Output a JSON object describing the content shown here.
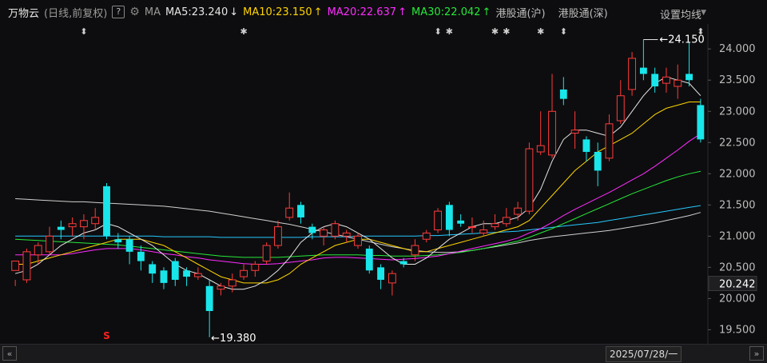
{
  "header": {
    "title": "万物云",
    "subtitle": "(日线,前复权)",
    "help": "?",
    "ma_label": "MA",
    "ma5": "MA5:23.240",
    "ma5_arrow": "↓",
    "ma10": "MA10:23.150",
    "ma10_arrow": "↑",
    "ma20": "MA20:22.637",
    "ma20_arrow": "↑",
    "ma30": "MA30:22.042",
    "ma30_arrow": "↑",
    "link_hk_sh": "港股通(沪)",
    "link_hk_sz": "港股通(深)",
    "settings": "设置均线"
  },
  "colors": {
    "up": "#ff3b3b",
    "down": "#18e6ea",
    "ma5": "#e6e6e6",
    "ma10": "#ffd400",
    "ma20": "#ff2cff",
    "ma30": "#27e83a",
    "ma60": "#27c8ff",
    "ma120": "#d0d0d0"
  },
  "footer": {
    "date": "2025/07/28/一",
    "left_icon": "double-chevron-left-icon",
    "right_icon": "double-chevron-right-icon"
  },
  "chart_data": {
    "type": "candlestick",
    "ylim": [
      19.3,
      24.4
    ],
    "y_ticks": [
      "24.000",
      "23.500",
      "23.000",
      "22.500",
      "22.000",
      "21.500",
      "21.000",
      "20.500",
      "20.000",
      "19.500"
    ],
    "y_tick_values": [
      24.0,
      23.5,
      23.0,
      22.5,
      22.0,
      21.5,
      21.0,
      20.5,
      20.0,
      19.5
    ],
    "current_price": "20.242",
    "current_price_value": 20.242,
    "high_annotation": {
      "label": "24.150",
      "value": 24.15
    },
    "low_annotation": {
      "label": "19.380",
      "value": 19.38
    },
    "candles": [
      [
        20.45,
        20.6,
        20.3,
        20.2
      ],
      [
        20.3,
        20.75,
        20.8,
        20.25
      ],
      [
        20.7,
        20.85,
        20.9,
        20.55
      ],
      [
        20.75,
        21.0,
        21.15,
        20.7
      ],
      [
        21.15,
        21.1,
        21.25,
        20.95
      ],
      [
        21.15,
        21.2,
        21.3,
        21.0
      ],
      [
        21.15,
        21.25,
        21.35,
        20.95
      ],
      [
        21.2,
        21.3,
        21.45,
        21.1
      ],
      [
        21.8,
        21.0,
        21.85,
        20.95
      ],
      [
        20.95,
        20.9,
        21.05,
        20.8
      ],
      [
        20.95,
        20.75,
        21.0,
        20.55
      ],
      [
        20.75,
        20.6,
        20.85,
        20.45
      ],
      [
        20.55,
        20.4,
        20.6,
        20.25
      ],
      [
        20.45,
        20.25,
        20.5,
        20.15
      ],
      [
        20.6,
        20.3,
        20.65,
        20.2
      ],
      [
        20.45,
        20.35,
        20.5,
        20.2
      ],
      [
        20.35,
        20.4,
        20.5,
        20.3
      ],
      [
        20.2,
        19.8,
        20.3,
        19.38
      ],
      [
        20.15,
        20.2,
        20.25,
        20.05
      ],
      [
        20.2,
        20.3,
        20.4,
        20.1
      ],
      [
        20.35,
        20.45,
        20.55,
        20.3
      ],
      [
        20.45,
        20.55,
        20.6,
        20.35
      ],
      [
        20.6,
        20.85,
        20.9,
        20.55
      ],
      [
        20.85,
        21.15,
        21.25,
        20.8
      ],
      [
        21.3,
        21.45,
        21.7,
        21.25
      ],
      [
        21.5,
        21.3,
        21.55,
        21.2
      ],
      [
        21.15,
        21.05,
        21.2,
        20.95
      ],
      [
        21.0,
        21.1,
        21.15,
        20.85
      ],
      [
        21.0,
        21.2,
        21.25,
        20.95
      ],
      [
        21.0,
        21.05,
        21.1,
        20.9
      ],
      [
        20.85,
        21.0,
        21.05,
        20.8
      ],
      [
        20.8,
        20.45,
        20.85,
        20.4
      ],
      [
        20.5,
        20.3,
        20.55,
        20.15
      ],
      [
        20.25,
        20.4,
        20.45,
        20.05
      ],
      [
        20.6,
        20.55,
        20.65,
        20.5
      ],
      [
        20.7,
        20.85,
        20.95,
        20.6
      ],
      [
        20.95,
        21.05,
        21.1,
        20.9
      ],
      [
        21.1,
        21.4,
        21.45,
        21.05
      ],
      [
        21.5,
        21.1,
        21.55,
        21.0
      ],
      [
        21.25,
        21.2,
        21.35,
        21.15
      ],
      [
        21.15,
        21.15,
        21.3,
        21.05
      ],
      [
        21.05,
        21.1,
        21.25,
        21.0
      ],
      [
        21.15,
        21.2,
        21.35,
        21.1
      ],
      [
        21.2,
        21.3,
        21.45,
        21.15
      ],
      [
        21.35,
        21.45,
        21.55,
        21.25
      ],
      [
        21.4,
        22.4,
        22.5,
        21.35
      ],
      [
        22.35,
        22.45,
        23.0,
        22.3
      ],
      [
        22.3,
        23.0,
        23.6,
        22.25
      ],
      [
        23.35,
        23.2,
        23.55,
        23.1
      ],
      [
        22.65,
        22.7,
        23.0,
        22.4
      ],
      [
        22.55,
        22.35,
        22.6,
        22.2
      ],
      [
        22.35,
        22.05,
        22.5,
        21.8
      ],
      [
        22.25,
        22.8,
        22.95,
        22.2
      ],
      [
        22.85,
        23.25,
        23.5,
        22.8
      ],
      [
        23.35,
        23.85,
        23.95,
        23.25
      ],
      [
        23.7,
        23.6,
        24.15,
        23.5
      ],
      [
        23.6,
        23.4,
        23.7,
        23.3
      ],
      [
        23.45,
        23.55,
        23.7,
        23.3
      ],
      [
        23.4,
        23.5,
        23.75,
        23.2
      ],
      [
        23.6,
        23.5,
        24.1,
        23.4
      ],
      [
        23.1,
        22.55,
        23.2,
        22.5
      ]
    ],
    "ma5": [
      20.4,
      20.45,
      20.55,
      20.7,
      20.85,
      20.95,
      21.05,
      21.1,
      21.2,
      21.15,
      21.05,
      20.95,
      20.85,
      20.7,
      20.55,
      20.45,
      20.4,
      20.3,
      20.2,
      20.15,
      20.15,
      20.2,
      20.3,
      20.45,
      20.65,
      20.9,
      21.05,
      21.15,
      21.2,
      21.15,
      21.05,
      20.95,
      20.8,
      20.65,
      20.55,
      20.55,
      20.65,
      20.8,
      20.95,
      21.05,
      21.15,
      21.2,
      21.2,
      21.25,
      21.3,
      21.45,
      21.75,
      22.2,
      22.55,
      22.7,
      22.7,
      22.65,
      22.6,
      22.75,
      23.0,
      23.25,
      23.45,
      23.55,
      23.5,
      23.45,
      23.25
    ],
    "ma10": [
      20.55,
      20.55,
      20.6,
      20.65,
      20.7,
      20.75,
      20.8,
      20.85,
      20.9,
      20.95,
      20.95,
      20.95,
      20.9,
      20.85,
      20.75,
      20.65,
      20.55,
      20.45,
      20.35,
      20.3,
      20.25,
      20.25,
      20.25,
      20.3,
      20.4,
      20.55,
      20.65,
      20.75,
      20.85,
      20.9,
      20.95,
      20.95,
      20.9,
      20.85,
      20.8,
      20.75,
      20.75,
      20.8,
      20.85,
      20.9,
      20.95,
      21.0,
      21.05,
      21.1,
      21.15,
      21.25,
      21.45,
      21.65,
      21.85,
      22.05,
      22.2,
      22.35,
      22.45,
      22.55,
      22.65,
      22.8,
      22.95,
      23.05,
      23.1,
      23.15,
      23.15
    ],
    "ma20": [
      20.7,
      20.7,
      20.7,
      20.7,
      20.7,
      20.72,
      20.75,
      20.78,
      20.8,
      20.8,
      20.8,
      20.78,
      20.75,
      20.72,
      20.7,
      20.67,
      20.65,
      20.62,
      20.6,
      20.58,
      20.56,
      20.55,
      20.55,
      20.56,
      20.58,
      20.6,
      20.62,
      20.65,
      20.66,
      20.66,
      20.65,
      20.64,
      20.63,
      20.62,
      20.63,
      20.64,
      20.66,
      20.68,
      20.72,
      20.76,
      20.8,
      20.84,
      20.88,
      20.92,
      20.97,
      21.05,
      21.12,
      21.22,
      21.33,
      21.43,
      21.52,
      21.61,
      21.7,
      21.8,
      21.9,
      22.0,
      22.12,
      22.25,
      22.38,
      22.52,
      22.64
    ],
    "ma30": [
      20.95,
      20.94,
      20.93,
      20.92,
      20.91,
      20.9,
      20.89,
      20.88,
      20.87,
      20.86,
      20.84,
      20.82,
      20.8,
      20.78,
      20.76,
      20.74,
      20.72,
      20.7,
      20.68,
      20.67,
      20.66,
      20.66,
      20.66,
      20.66,
      20.67,
      20.68,
      20.69,
      20.7,
      20.7,
      20.7,
      20.7,
      20.69,
      20.69,
      20.68,
      20.68,
      20.68,
      20.69,
      20.7,
      20.72,
      20.74,
      20.77,
      20.8,
      20.84,
      20.88,
      20.92,
      20.98,
      21.05,
      21.12,
      21.2,
      21.28,
      21.36,
      21.44,
      21.52,
      21.6,
      21.68,
      21.75,
      21.82,
      21.89,
      21.95,
      22.0,
      22.04
    ],
    "ma60": [
      21.0,
      21.0,
      21.0,
      21.0,
      21.0,
      21.0,
      21.0,
      21.0,
      21.0,
      21.0,
      21.0,
      21.0,
      21.0,
      20.99,
      20.99,
      20.99,
      20.99,
      20.99,
      20.98,
      20.98,
      20.98,
      20.98,
      20.98,
      20.98,
      20.98,
      20.98,
      20.99,
      20.99,
      20.99,
      20.99,
      21.0,
      21.0,
      21.0,
      21.0,
      21.0,
      21.0,
      21.01,
      21.01,
      21.02,
      21.03,
      21.04,
      21.05,
      21.06,
      21.07,
      21.08,
      21.1,
      21.12,
      21.14,
      21.16,
      21.18,
      21.2,
      21.22,
      21.25,
      21.28,
      21.31,
      21.34,
      21.37,
      21.4,
      21.43,
      21.46,
      21.49
    ],
    "ma120": [
      21.6,
      21.59,
      21.58,
      21.57,
      21.56,
      21.55,
      21.55,
      21.54,
      21.53,
      21.52,
      21.51,
      21.5,
      21.49,
      21.48,
      21.46,
      21.44,
      21.42,
      21.4,
      21.37,
      21.34,
      21.31,
      21.28,
      21.25,
      21.22,
      21.19,
      21.15,
      21.11,
      21.07,
      21.03,
      20.99,
      20.95,
      20.91,
      20.87,
      20.83,
      20.8,
      20.77,
      20.75,
      20.74,
      20.74,
      20.75,
      20.77,
      20.8,
      20.83,
      20.86,
      20.89,
      20.93,
      20.96,
      20.99,
      21.01,
      21.03,
      21.05,
      21.07,
      21.09,
      21.12,
      21.15,
      21.18,
      21.21,
      21.25,
      21.29,
      21.33,
      21.38
    ],
    "event_markers": [
      {
        "index": 6,
        "symbol": "⬍"
      },
      {
        "index": 20,
        "symbol": "✱"
      },
      {
        "index": 37,
        "symbol": "⬍"
      },
      {
        "index": 38,
        "symbol": "✱"
      },
      {
        "index": 42,
        "symbol": "✱"
      },
      {
        "index": 43,
        "symbol": "✱"
      },
      {
        "index": 46,
        "symbol": "✱"
      },
      {
        "index": 48,
        "symbol": "⬍"
      },
      {
        "index": 60,
        "symbol": "⬍"
      }
    ],
    "s_marker": {
      "index": 8,
      "label": "S"
    }
  }
}
